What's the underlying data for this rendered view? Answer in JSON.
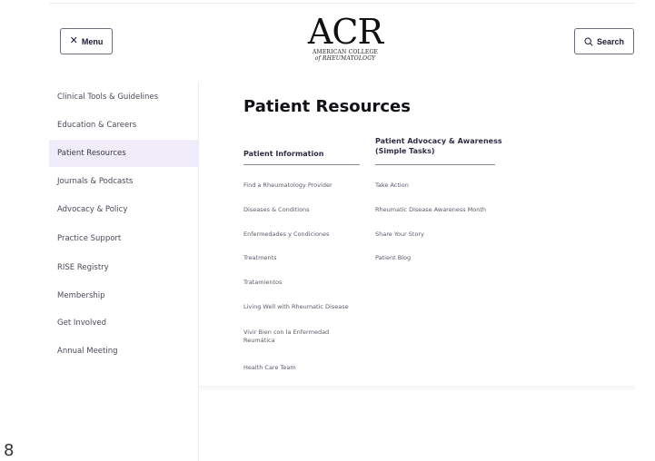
{
  "header": {
    "menu_label": "Menu",
    "search_label": "Search",
    "logo": {
      "mark": "ACR",
      "line1": "AMERICAN COLLEGE",
      "line2": "of RHEUMATOLOGY"
    }
  },
  "sidebar": {
    "items": [
      {
        "label": "Clinical Tools & Guidelines",
        "active": false
      },
      {
        "label": "Education & Careers",
        "active": false
      },
      {
        "label": "Patient Resources",
        "active": true
      },
      {
        "label": "Journals & Podcasts",
        "active": false
      },
      {
        "label": "Advocacy & Policy",
        "active": false
      },
      {
        "label": "Practice Support",
        "active": false
      },
      {
        "label": "RISE Registry",
        "active": false
      },
      {
        "label": "Membership",
        "active": false
      },
      {
        "label": "Get Involved",
        "active": false
      },
      {
        "label": "Annual Meeting",
        "active": false
      }
    ]
  },
  "main": {
    "title": "Patient Resources",
    "columns": [
      {
        "heading": "Patient Information",
        "links": [
          "Find a Rheumatology Provider",
          "Diseases & Conditions",
          "Enfermedades y Condiciones",
          "Treatments",
          "Tratamientos",
          "Living Well with Rheumatic Disease",
          "Vivir Bien con la Enfermedad Reumática",
          "Health Care Team"
        ]
      },
      {
        "heading": "Patient Advocacy & Awareness (Simple Tasks)",
        "links": [
          "Take Action",
          "Rheumatic Disease Awareness Month",
          "Share Your Story",
          "Patient Blog"
        ]
      }
    ]
  },
  "colors": {
    "active_bg": "#f0ecfa",
    "text_dark": "#111118",
    "nav_text": "#4a4a58",
    "link_text": "#5a5a6a"
  },
  "corner_glyph": "8"
}
